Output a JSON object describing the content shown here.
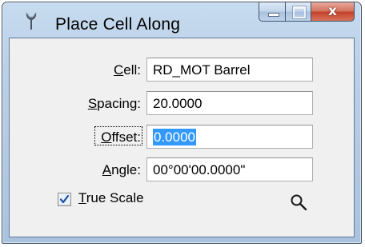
{
  "window": {
    "title": "Place Cell Along",
    "close_glyph": "x"
  },
  "form": {
    "cell": {
      "label_mnemonic": "C",
      "label_rest": "ell:",
      "value": "RD_MOT Barrel"
    },
    "spacing": {
      "label_mnemonic": "S",
      "label_rest": "pacing:",
      "value": "20.0000"
    },
    "offset": {
      "label_mnemonic": "O",
      "label_rest": "ffset:",
      "value": "0.0000",
      "selected": true
    },
    "angle": {
      "label_mnemonic": "A",
      "label_rest": "ngle:",
      "value": "00°00'00.0000\""
    },
    "true_scale": {
      "label_mnemonic": "T",
      "label_rest": "rue Scale",
      "checked": true
    }
  },
  "icons": {
    "app": "microstation-pen-icon",
    "zoom": "magnifier-icon",
    "minimize": "minimize-icon",
    "maximize": "maximize-icon",
    "close": "close-icon"
  },
  "colors": {
    "selection": "#3399ff",
    "close_button": "#c2412a",
    "frame": "#b9d0e8"
  }
}
